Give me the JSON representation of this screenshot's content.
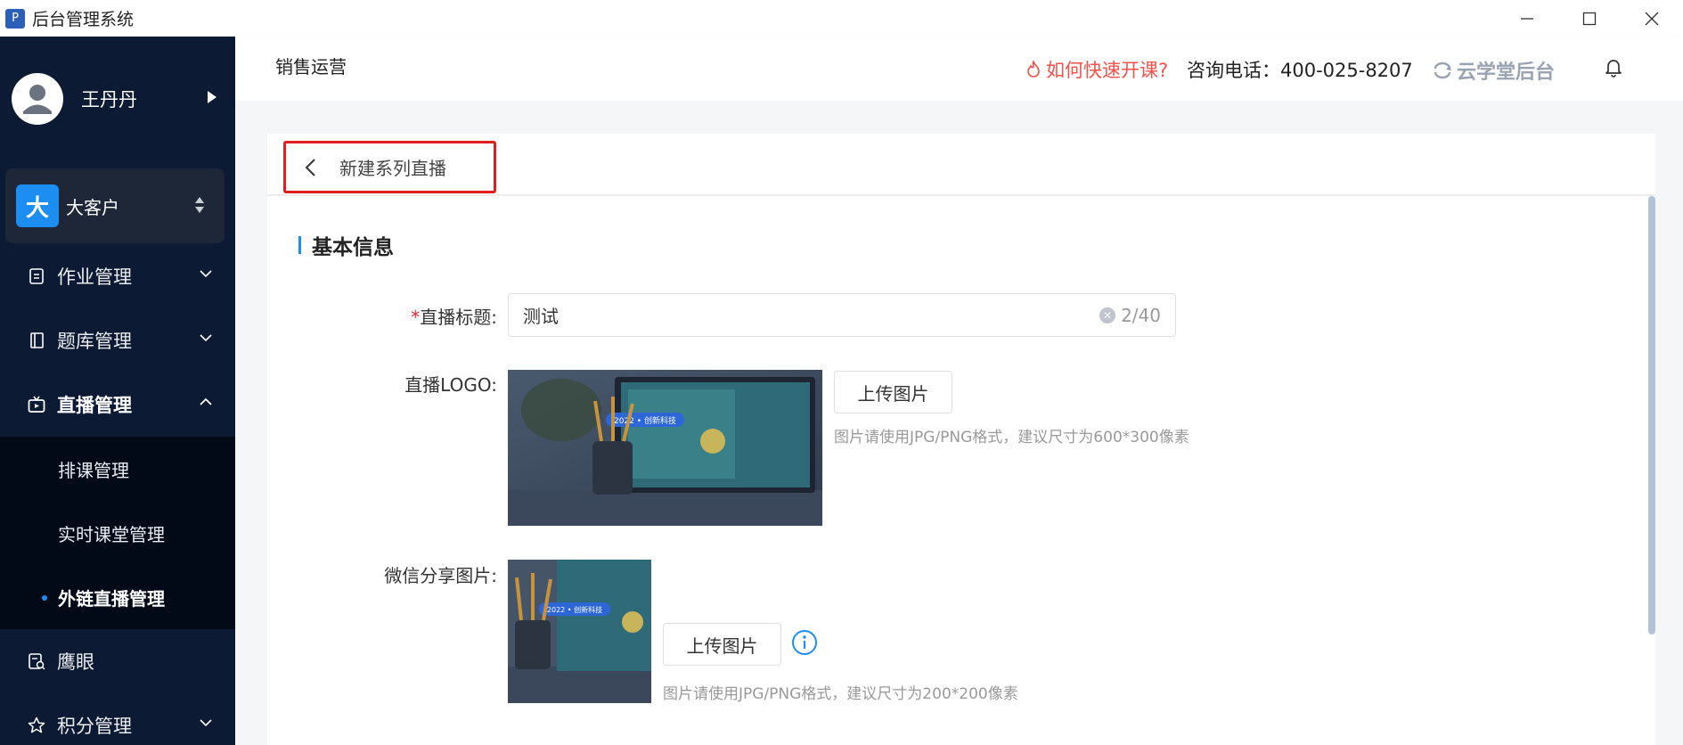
{
  "window": {
    "icon_letter": "P",
    "title": "后台管理系统"
  },
  "sidebar": {
    "user_name": "王丹丹",
    "org": {
      "badge": "大",
      "name": "大客户"
    },
    "menu": [
      {
        "label": "作业管理"
      },
      {
        "label": "题库管理"
      },
      {
        "label": "直播管理"
      },
      {
        "label": "鹰眼"
      },
      {
        "label": "积分管理"
      }
    ],
    "submenu": [
      {
        "label": "排课管理"
      },
      {
        "label": "实时课堂管理"
      },
      {
        "label": "外链直播管理"
      }
    ]
  },
  "header": {
    "breadcrumb": "销售运营",
    "help_link": "如何快速开课?",
    "phone": "咨询电话：400-025-8207",
    "brand": "云学堂后台"
  },
  "page": {
    "back_title": "新建系列直播",
    "section_title": "基本信息",
    "fields": {
      "title_label": "直播标题:",
      "title_required_mark": "*",
      "title_value": "测试",
      "title_count": "2/40",
      "logo_label": "直播LOGO:",
      "logo_upload": "上传图片",
      "logo_hint": "图片请使用JPG/PNG格式，建议尺寸为600*300像素",
      "share_label": "微信分享图片:",
      "share_upload": "上传图片",
      "share_hint": "图片请使用JPG/PNG格式，建议尺寸为200*200像素"
    },
    "image_badge": "2022 • 创新科技"
  },
  "colors": {
    "sidebar_bg": "#0c1a33",
    "accent": "#1d8ef1",
    "danger": "#f5504a",
    "highlight_border": "#e11d1d"
  }
}
